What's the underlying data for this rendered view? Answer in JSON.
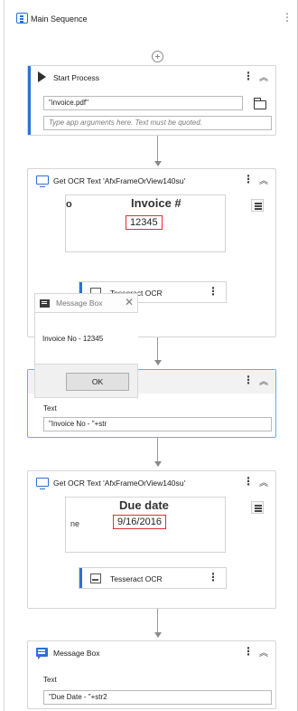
{
  "header": {
    "title": "Main Sequence"
  },
  "start_process": {
    "title": "Start Process",
    "file_value": "\"invoice.pdf\"",
    "args_placeholder": "Type app arguments here. Text must be quoted."
  },
  "ocr1": {
    "title": "Get OCR Text 'AfxFrameOrView140su'",
    "preview_left_char": "o",
    "preview_heading": "Invoice #",
    "preview_value": "12345",
    "engine_label": "Tesseract OCR"
  },
  "dialog": {
    "title": "Message Box",
    "message": "Invoice No - 12345",
    "ok_label": "OK"
  },
  "msgbox1": {
    "field_label": "Text",
    "field_value": "\"Invoice No - \"+str"
  },
  "ocr2": {
    "title": "Get OCR Text 'AfxFrameOrView140su'",
    "preview_left_text": "ne",
    "preview_heading": "Due date",
    "preview_value": "9/16/2016",
    "engine_label": "Tesseract OCR"
  },
  "msgbox2": {
    "title": "Message Box",
    "field_label": "Text",
    "field_value": "\"Due Date - \"+str2"
  },
  "colors": {
    "accent": "#2f6fd6",
    "highlight": "#e03030",
    "selected_border": "#6fa7e6"
  }
}
